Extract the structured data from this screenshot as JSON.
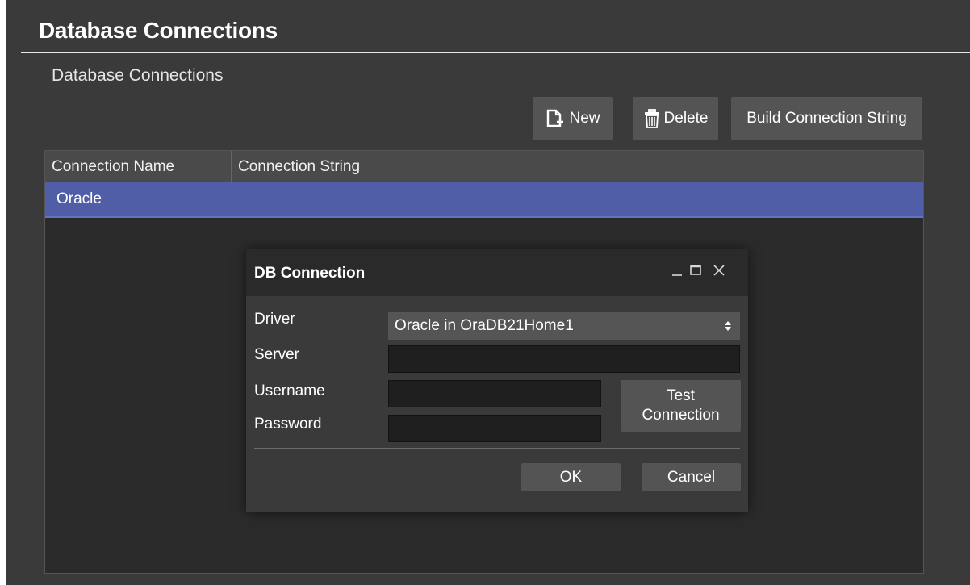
{
  "page": {
    "title": "Database Connections",
    "group_label": "Database Connections"
  },
  "toolbar": {
    "new_label": "New",
    "delete_label": "Delete",
    "build_label": "Build Connection String"
  },
  "grid": {
    "columns": [
      "Connection Name",
      "Connection String"
    ],
    "rows": [
      {
        "name": "Oracle",
        "connection_string": "",
        "selected": true
      }
    ]
  },
  "dialog": {
    "title": "DB Connection",
    "driver_label": "Driver",
    "driver_value": "Oracle in OraDB21Home1",
    "server_label": "Server",
    "server_value": "",
    "username_label": "Username",
    "username_value": "",
    "password_label": "Password",
    "password_value": "",
    "test_button_label": "Test Connection",
    "ok_label": "OK",
    "cancel_label": "Cancel"
  },
  "colors": {
    "background": "#3a3a3a",
    "selection": "#4f5ea6",
    "button": "#545454",
    "input": "#1f1f1f"
  },
  "icons": {
    "new": "new-document-icon",
    "delete": "trash-icon",
    "minimize": "minimize-icon",
    "maximize": "maximize-icon",
    "close": "close-icon",
    "dropdown": "updown-arrows-icon"
  }
}
